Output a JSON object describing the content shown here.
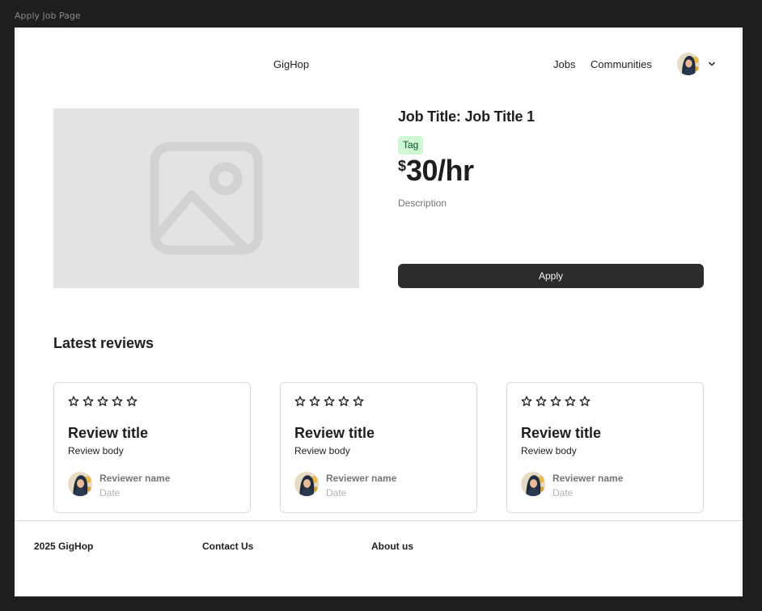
{
  "frame": {
    "label": "Apply Job Page"
  },
  "header": {
    "brand": "GigHop",
    "nav": {
      "jobs": "Jobs",
      "communities": "Communities"
    },
    "avatar_icon": "user-avatar",
    "menu_icon": "chevron-down-icon"
  },
  "job": {
    "image_icon": "image-placeholder-icon",
    "title": "Job Title: Job Title 1",
    "tag": "Tag",
    "price_currency": "$",
    "price_amount": "30/hr",
    "description": "Description",
    "apply_label": "Apply"
  },
  "reviews": {
    "heading": "Latest reviews",
    "star_icon": "star-outline-icon",
    "items": [
      {
        "title": "Review title",
        "body": "Review body",
        "reviewer": "Reviewer name",
        "date": "Date",
        "stars_filled": 0,
        "stars_total": 5
      },
      {
        "title": "Review title",
        "body": "Review body",
        "reviewer": "Reviewer name",
        "date": "Date",
        "stars_filled": 0,
        "stars_total": 5
      },
      {
        "title": "Review title",
        "body": "Review body",
        "reviewer": "Reviewer name",
        "date": "Date",
        "stars_filled": 0,
        "stars_total": 5
      }
    ]
  },
  "footer": {
    "copyright": "2025 GigHop",
    "contact": "Contact Us",
    "about": "About us"
  },
  "colors": {
    "page_bg": "#1e1e1e",
    "surface": "#ffffff",
    "text_primary": "#1e1e1e",
    "text_secondary": "#757575",
    "text_tertiary": "#b3b3b3",
    "placeholder": "#e3e3e3",
    "button_bg": "#2c2c2c",
    "tag_bg": "#cff7d3",
    "tag_text": "#02542d",
    "border": "#d9d9d9"
  }
}
